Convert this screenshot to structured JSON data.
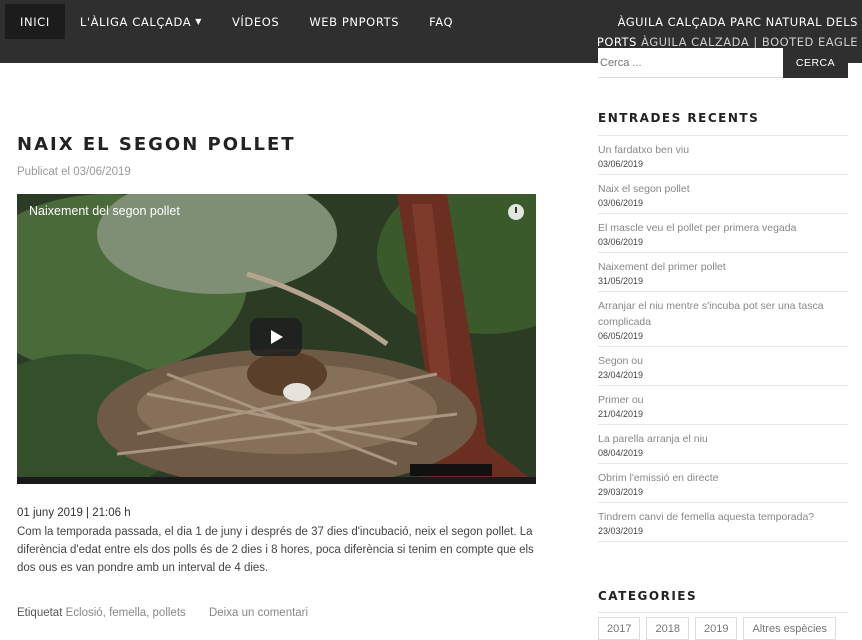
{
  "nav": {
    "items": [
      {
        "label": "INICI",
        "active": true
      },
      {
        "label": "L'ÀLIGA CALÇADA",
        "has_dropdown": true
      },
      {
        "label": "VÍDEOS"
      },
      {
        "label": "WEB PNPORTS"
      },
      {
        "label": "FAQ"
      }
    ],
    "dropdown_icon": "chevron-down-icon"
  },
  "site": {
    "title": "ÀGUILA CALÇADA PARC NATURAL DELS PORTS",
    "description": "ÀGUILA CALZADA | BOOTED EAGLE"
  },
  "post": {
    "title": "NAIX EL SEGON POLLET",
    "meta": "Publicat el 03/06/2019",
    "video_title": "Naixement del segon pollet",
    "date_line": "01 juny 2019 | 21:06 h",
    "body": "Com la temporada passada, el dia 1 de juny i després de 37 dies d'incubació, neix el segon pollet. La diferència d'edat entre els dos polls és de 2 dies i 8 hores, poca diferència si tenim en compte que els dos ous es van pondre amb un interval de 4 dies.",
    "tags_label": "Etiquetat",
    "tags": "Eclosió, femella, pollets",
    "comment_link": "Deixa un comentari"
  },
  "sidebar": {
    "search_placeholder": "Cerca ...",
    "search_button": "CERCA",
    "recent_title": "ENTRADES RECENTS",
    "recent": [
      {
        "title": "Un fardatxo ben viu",
        "date": "03/06/2019"
      },
      {
        "title": "Naix el segon pollet",
        "date": "03/06/2019"
      },
      {
        "title": "El mascle veu el pollet per primera vegada",
        "date": "03/06/2019"
      },
      {
        "title": "Naixement del primer pollet",
        "date": "31/05/2019"
      },
      {
        "title": "Arranjar el niu mentre s'incuba pot ser una tasca complicada",
        "date": "06/05/2019"
      },
      {
        "title": "Segon ou",
        "date": "23/04/2019"
      },
      {
        "title": "Primer ou",
        "date": "21/04/2019"
      },
      {
        "title": "La parella arranja el niu",
        "date": "08/04/2019"
      },
      {
        "title": "Obrim l'emissió en directe",
        "date": "29/03/2019"
      },
      {
        "title": "Tindrem canvi de femella aquesta temporada?",
        "date": "23/03/2019"
      }
    ],
    "categories_title": "CATEGORIES",
    "categories": [
      "2017",
      "2018",
      "2019",
      "Altres espècies"
    ]
  },
  "colors": {
    "nav_bg": "#2f2f2f",
    "active_bg": "#1c1c1c",
    "muted_text": "#888888"
  }
}
